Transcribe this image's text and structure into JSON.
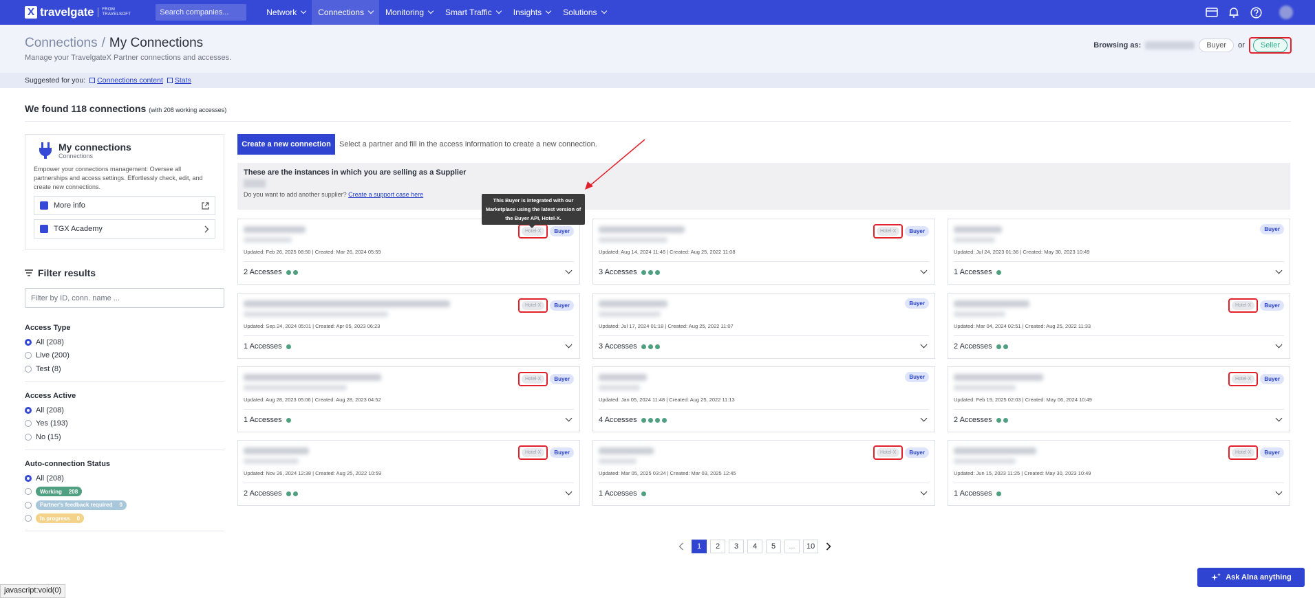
{
  "nav": {
    "logo_text": "travelgate",
    "logo_from": "FROM",
    "logo_brand": "TRAVELSOFT",
    "search_placeholder": "Search companies...",
    "menu": [
      "Network",
      "Connections",
      "Monitoring",
      "Smart Traffic",
      "Insights",
      "Solutions"
    ],
    "active_menu": "Connections",
    "icons": [
      "card-icon",
      "bell-icon",
      "help-icon",
      "avatar"
    ]
  },
  "header": {
    "breadcrumb_parent": "Connections",
    "breadcrumb_separator": "/",
    "breadcrumb_current": "My Connections",
    "subtitle": "Manage your TravelgateX Partner connections and accesses.",
    "browsing_label": "Browsing as:",
    "buyer_label": "Buyer",
    "or_label": "or",
    "seller_label": "Seller"
  },
  "suggested": {
    "label": "Suggested for you:",
    "links": [
      "Connections content",
      "Stats"
    ]
  },
  "summary": {
    "title": "We found 118 connections",
    "note": "(with 208 working accesses)"
  },
  "sidebar": {
    "card_title": "My connections",
    "card_subtitle": "Connections",
    "card_description": "Empower your connections management: Oversee all partnerships and access settings. Effortlessly check, edit, and create new connections.",
    "links": [
      "More info",
      "TGX Academy"
    ],
    "filter_title": "Filter results",
    "filter_placeholder": "Filter by ID, conn. name ...",
    "groups": [
      {
        "title": "Access Type",
        "options": [
          "All (208)",
          "Live (200)",
          "Test (8)"
        ],
        "selected": 0
      },
      {
        "title": "Access Active",
        "options": [
          "All (208)",
          "Yes (193)",
          "No (15)"
        ],
        "selected": 0
      },
      {
        "title": "Auto-connection Status",
        "options": [
          "All (208)"
        ],
        "selected": 0
      }
    ],
    "status_tags": [
      {
        "label": "Working",
        "count": "208"
      },
      {
        "label": "Partner's feedback required",
        "count": "0"
      },
      {
        "label": "In progress",
        "count": "0"
      }
    ]
  },
  "main": {
    "create_button": "Create a new connection",
    "create_hint": "Select a partner and fill in the access information to create a new connection.",
    "instances_title": "These are the instances in which you are selling as a Supplier",
    "support_text": "Do you want to add another supplier?",
    "support_link": "Create a support case here",
    "tooltip": "This Buyer is integrated with our Marketplace using the latest version of the Buyer API, Hotel-X.",
    "hotelx_label": "Hotel-X",
    "buyer_label": "Buyer"
  },
  "cards": [
    {
      "updated": "Updated: Feb 26, 2025 08:50",
      "created": "Created: Mar 26, 2024 05:59",
      "accesses": "2 Accesses",
      "dots": 2,
      "hotelx": true
    },
    {
      "updated": "Updated: Aug 14, 2024 11:46",
      "created": "Created: Aug 25, 2022 11:08",
      "accesses": "3 Accesses",
      "dots": 3,
      "hotelx": true
    },
    {
      "updated": "Updated: Jul 24, 2023 01:36",
      "created": "Created: May 30, 2023 10:49",
      "accesses": "1 Accesses",
      "dots": 1,
      "hotelx": false
    },
    {
      "updated": "Updated: Sep 24, 2024 05:01",
      "created": "Created: Apr 05, 2023 06:23",
      "accesses": "1 Accesses",
      "dots": 1,
      "hotelx": true
    },
    {
      "updated": "Updated: Jul 17, 2024 01:18",
      "created": "Created: Aug 25, 2022 11:07",
      "accesses": "3 Accesses",
      "dots": 3,
      "hotelx": false
    },
    {
      "updated": "Updated: Mar 04, 2024 02:51",
      "created": "Created: Aug 25, 2022 11:33",
      "accesses": "2 Accesses",
      "dots": 2,
      "hotelx": true
    },
    {
      "updated": "Updated: Aug 28, 2023 05:06",
      "created": "Created: Aug 28, 2023 04:52",
      "accesses": "1 Accesses",
      "dots": 1,
      "hotelx": true
    },
    {
      "updated": "Updated: Jan 05, 2024 11:48",
      "created": "Created: Aug 25, 2022 11:13",
      "accesses": "4 Accesses",
      "dots": 4,
      "hotelx": false
    },
    {
      "updated": "Updated: Feb 19, 2025 02:03",
      "created": "Created: May 06, 2024 10:49",
      "accesses": "2 Accesses",
      "dots": 2,
      "hotelx": true
    },
    {
      "updated": "Updated: Nov 26, 2024 12:38",
      "created": "Created: Aug 25, 2022 10:59",
      "accesses": "2 Accesses",
      "dots": 2,
      "hotelx": true
    },
    {
      "updated": "Updated: Mar 05, 2025 03:24",
      "created": "Created: Mar 03, 2025 12:45",
      "accesses": "1 Accesses",
      "dots": 1,
      "hotelx": true
    },
    {
      "updated": "Updated: Jun 15, 2023 11:25",
      "created": "Created: May 30, 2023 10:49",
      "accesses": "1 Accesses",
      "dots": 1,
      "hotelx": true
    }
  ],
  "pagination": {
    "pages": [
      "1",
      "2",
      "3",
      "4",
      "5",
      "...",
      "10"
    ],
    "current": "1"
  },
  "assistant": {
    "label": "Ask Alna anything"
  },
  "status_bar": "javascript:void(0)",
  "colors": {
    "primary": "#3548d6",
    "working": "#4fa080",
    "highlight": "#e0202a"
  }
}
